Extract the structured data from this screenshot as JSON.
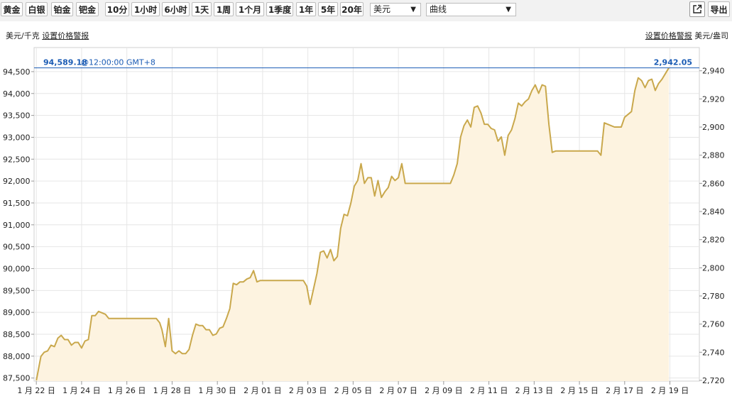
{
  "toolbar": {
    "metals": [
      "黄金",
      "白银",
      "铂金",
      "钯金"
    ],
    "ranges": [
      "10分",
      "1小时",
      "6小时",
      "1天",
      "1周",
      "1个月",
      "1季度",
      "1年",
      "5年",
      "20年"
    ],
    "active_metal": "黄金",
    "active_range": "1个月",
    "currency": "美元",
    "chart_style": "曲线",
    "export_label": "导出",
    "popout_icon": "popout-icon"
  },
  "labels": {
    "left_unit": "美元/千克",
    "left_alert": "设置价格警报",
    "right_alert": "设置价格警报",
    "right_unit": "美元/盎司"
  },
  "colors": {
    "line": "#c9a84c",
    "fill": "#fdf3e0",
    "crosshair": "#1a5bb4",
    "grid": "#e6e6e6"
  },
  "chart_data": {
    "type": "area",
    "title": "",
    "crosshair": {
      "left_value": "94,589.18",
      "time": "@12:00:00 GMT+8",
      "right_value": "2,942.05"
    },
    "x_ticks": [
      "1 月 22 日",
      "1 月 24 日",
      "1 月 26 日",
      "1 月 28 日",
      "1 月 30 日",
      "2 月 01 日",
      "2 月 03 日",
      "2 月 05 日",
      "2 月 07 日",
      "2 月 09 日",
      "2 月 11 日",
      "2 月 13 日",
      "2 月 15 日",
      "2 月 17 日",
      "2 月 19 日"
    ],
    "x_range": [
      -0.1,
      29.3
    ],
    "y_left_ticks": [
      "87,500",
      "88,000",
      "88,500",
      "89,000",
      "89,500",
      "90,000",
      "90,500",
      "91,000",
      "91,500",
      "92,000",
      "92,500",
      "93,000",
      "93,500",
      "94,000",
      "94,500"
    ],
    "y_left_range": [
      87430,
      95050
    ],
    "y_right_ticks": [
      "2,720",
      "2,740",
      "2,760",
      "2,780",
      "2,800",
      "2,820",
      "2,840",
      "2,860",
      "2,880",
      "2,900",
      "2,920",
      "2,940"
    ],
    "y_right_range": [
      2719.5,
      2956.5
    ],
    "series": [
      {
        "unit": "美元/盎司",
        "points": [
          [
            0,
            2720
          ],
          [
            0.2,
            2737
          ],
          [
            0.35,
            2740
          ],
          [
            0.5,
            2741
          ],
          [
            0.65,
            2745
          ],
          [
            0.8,
            2744
          ],
          [
            0.95,
            2750
          ],
          [
            1.1,
            2752
          ],
          [
            1.25,
            2749
          ],
          [
            1.4,
            2749
          ],
          [
            1.55,
            2745
          ],
          [
            1.7,
            2747
          ],
          [
            1.85,
            2747
          ],
          [
            2.0,
            2743
          ],
          [
            2.15,
            2748
          ],
          [
            2.3,
            2749
          ],
          [
            2.45,
            2766
          ],
          [
            2.6,
            2766
          ],
          [
            2.75,
            2769
          ],
          [
            2.9,
            2768
          ],
          [
            3.05,
            2767
          ],
          [
            3.2,
            2764
          ],
          [
            3.5,
            2764
          ],
          [
            4.0,
            2764
          ],
          [
            4.5,
            2764
          ],
          [
            5.0,
            2764
          ],
          [
            5.3,
            2764
          ],
          [
            5.45,
            2761
          ],
          [
            5.55,
            2756
          ],
          [
            5.7,
            2744
          ],
          [
            5.85,
            2764
          ],
          [
            6.0,
            2741
          ],
          [
            6.15,
            2739
          ],
          [
            6.3,
            2741
          ],
          [
            6.45,
            2739
          ],
          [
            6.6,
            2739
          ],
          [
            6.75,
            2742
          ],
          [
            6.9,
            2752
          ],
          [
            7.05,
            2760
          ],
          [
            7.2,
            2759
          ],
          [
            7.35,
            2759
          ],
          [
            7.5,
            2756
          ],
          [
            7.65,
            2756
          ],
          [
            7.8,
            2752
          ],
          [
            7.95,
            2753
          ],
          [
            8.1,
            2757
          ],
          [
            8.25,
            2758
          ],
          [
            8.4,
            2764
          ],
          [
            8.55,
            2771
          ],
          [
            8.7,
            2789
          ],
          [
            8.85,
            2788
          ],
          [
            9.0,
            2790
          ],
          [
            9.15,
            2790
          ],
          [
            9.3,
            2792
          ],
          [
            9.45,
            2793
          ],
          [
            9.6,
            2798
          ],
          [
            9.75,
            2790
          ],
          [
            9.9,
            2791
          ],
          [
            10.5,
            2791
          ],
          [
            11.0,
            2791
          ],
          [
            11.5,
            2791
          ],
          [
            11.8,
            2791
          ],
          [
            11.95,
            2787
          ],
          [
            12.1,
            2774
          ],
          [
            12.25,
            2785
          ],
          [
            12.4,
            2796
          ],
          [
            12.55,
            2811
          ],
          [
            12.7,
            2812
          ],
          [
            12.85,
            2807
          ],
          [
            13.0,
            2813
          ],
          [
            13.15,
            2805
          ],
          [
            13.3,
            2808
          ],
          [
            13.45,
            2828
          ],
          [
            13.6,
            2838
          ],
          [
            13.75,
            2837
          ],
          [
            13.9,
            2846
          ],
          [
            14.05,
            2858
          ],
          [
            14.2,
            2862
          ],
          [
            14.35,
            2874
          ],
          [
            14.5,
            2860
          ],
          [
            14.65,
            2864
          ],
          [
            14.8,
            2864
          ],
          [
            14.95,
            2851
          ],
          [
            15.1,
            2862
          ],
          [
            15.25,
            2850
          ],
          [
            15.4,
            2854
          ],
          [
            15.55,
            2857
          ],
          [
            15.7,
            2865
          ],
          [
            15.85,
            2862
          ],
          [
            16.0,
            2864
          ],
          [
            16.15,
            2874
          ],
          [
            16.3,
            2860
          ],
          [
            16.8,
            2860
          ],
          [
            17.5,
            2860
          ],
          [
            18.0,
            2860
          ],
          [
            18.3,
            2860
          ],
          [
            18.45,
            2866
          ],
          [
            18.6,
            2874
          ],
          [
            18.75,
            2893
          ],
          [
            18.9,
            2901
          ],
          [
            19.05,
            2905
          ],
          [
            19.2,
            2900
          ],
          [
            19.35,
            2914
          ],
          [
            19.5,
            2915
          ],
          [
            19.65,
            2910
          ],
          [
            19.8,
            2902
          ],
          [
            19.95,
            2902
          ],
          [
            20.1,
            2899
          ],
          [
            20.25,
            2898
          ],
          [
            20.4,
            2890
          ],
          [
            20.55,
            2893
          ],
          [
            20.7,
            2880
          ],
          [
            20.85,
            2894
          ],
          [
            21.0,
            2898
          ],
          [
            21.15,
            2906
          ],
          [
            21.3,
            2917
          ],
          [
            21.45,
            2915
          ],
          [
            21.6,
            2918
          ],
          [
            21.75,
            2920
          ],
          [
            21.9,
            2926
          ],
          [
            22.05,
            2930
          ],
          [
            22.2,
            2924
          ],
          [
            22.35,
            2930
          ],
          [
            22.5,
            2929
          ],
          [
            22.65,
            2902
          ],
          [
            22.8,
            2882
          ],
          [
            22.95,
            2883
          ],
          [
            23.5,
            2883
          ],
          [
            24.0,
            2883
          ],
          [
            24.5,
            2883
          ],
          [
            24.8,
            2883
          ],
          [
            24.95,
            2880
          ],
          [
            25.1,
            2903
          ],
          [
            25.25,
            2902
          ],
          [
            25.4,
            2901
          ],
          [
            25.55,
            2900
          ],
          [
            25.7,
            2900
          ],
          [
            25.85,
            2900
          ],
          [
            26.0,
            2907
          ],
          [
            26.15,
            2909
          ],
          [
            26.3,
            2911
          ],
          [
            26.45,
            2926
          ],
          [
            26.6,
            2935
          ],
          [
            26.75,
            2933
          ],
          [
            26.9,
            2928
          ],
          [
            27.05,
            2933
          ],
          [
            27.2,
            2934
          ],
          [
            27.35,
            2926
          ],
          [
            27.5,
            2931
          ],
          [
            27.65,
            2934
          ],
          [
            27.8,
            2938
          ],
          [
            27.95,
            2942
          ]
        ]
      }
    ]
  }
}
